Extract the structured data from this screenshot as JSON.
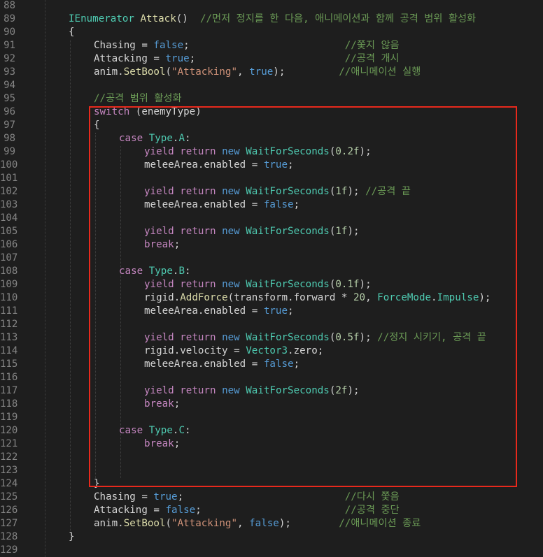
{
  "editor": {
    "theme": "dark",
    "colors": {
      "background": "#1e1e1e",
      "line_number": "#858585",
      "type": "#4ec9b0",
      "function": "#dcdcaa",
      "keyword": "#569cd6",
      "control": "#c586c0",
      "string": "#ce9178",
      "number": "#b5cea8",
      "comment": "#6a9955",
      "highlight_box": "#e8291c"
    },
    "line_numbers": [
      "88",
      "89",
      "90",
      "91",
      "92",
      "93",
      "94",
      "95",
      "96",
      "97",
      "98",
      "99",
      "100",
      "101",
      "102",
      "103",
      "104",
      "105",
      "106",
      "107",
      "108",
      "109",
      "110",
      "111",
      "112",
      "113",
      "114",
      "115",
      "116",
      "117",
      "118",
      "119",
      "120",
      "121",
      "122",
      "123",
      "124",
      "125",
      "126",
      "127",
      "128",
      "129"
    ],
    "lines": [
      [],
      [
        {
          "t": "IEnumerator",
          "c": "type"
        },
        {
          "t": " "
        },
        {
          "t": "Attack",
          "c": "fn"
        },
        {
          "t": "()  "
        },
        {
          "t": "//먼저 정지를 한 다음, 애니메이션과 함께 공격 범위 활성화",
          "c": "cmt"
        }
      ],
      [
        {
          "t": "{"
        }
      ],
      [
        {
          "t": "Chasing"
        },
        {
          "t": " = "
        },
        {
          "t": "false",
          "c": "kw"
        },
        {
          "t": ";                          "
        },
        {
          "t": "//쫓지 않음",
          "c": "cmt"
        }
      ],
      [
        {
          "t": "Attacking"
        },
        {
          "t": " = "
        },
        {
          "t": "true",
          "c": "kw"
        },
        {
          "t": ";                         "
        },
        {
          "t": "//공격 개시",
          "c": "cmt"
        }
      ],
      [
        {
          "t": "anim"
        },
        {
          "t": "."
        },
        {
          "t": "SetBool",
          "c": "fn"
        },
        {
          "t": "("
        },
        {
          "t": "\"Attacking\"",
          "c": "str"
        },
        {
          "t": ", "
        },
        {
          "t": "true",
          "c": "kw"
        },
        {
          "t": ");         "
        },
        {
          "t": "//애니메이션 실행",
          "c": "cmt"
        }
      ],
      [],
      [
        {
          "t": "//공격 범위 활성화",
          "c": "cmt"
        }
      ],
      [
        {
          "t": "switch",
          "c": "ctrl"
        },
        {
          "t": " (enemyType)"
        }
      ],
      [
        {
          "t": "{"
        }
      ],
      [
        {
          "t": "case",
          "c": "ctrl"
        },
        {
          "t": " "
        },
        {
          "t": "Type",
          "c": "type"
        },
        {
          "t": "."
        },
        {
          "t": "A",
          "c": "type"
        },
        {
          "t": ":"
        }
      ],
      [
        {
          "t": "yield",
          "c": "ctrl"
        },
        {
          "t": " "
        },
        {
          "t": "return",
          "c": "ctrl"
        },
        {
          "t": " "
        },
        {
          "t": "new",
          "c": "kw"
        },
        {
          "t": " "
        },
        {
          "t": "WaitForSeconds",
          "c": "type"
        },
        {
          "t": "("
        },
        {
          "t": "0.2f",
          "c": "num"
        },
        {
          "t": ");"
        }
      ],
      [
        {
          "t": "meleeArea"
        },
        {
          "t": "."
        },
        {
          "t": "enabled"
        },
        {
          "t": " = "
        },
        {
          "t": "true",
          "c": "kw"
        },
        {
          "t": ";"
        }
      ],
      [],
      [
        {
          "t": "yield",
          "c": "ctrl"
        },
        {
          "t": " "
        },
        {
          "t": "return",
          "c": "ctrl"
        },
        {
          "t": " "
        },
        {
          "t": "new",
          "c": "kw"
        },
        {
          "t": " "
        },
        {
          "t": "WaitForSeconds",
          "c": "type"
        },
        {
          "t": "("
        },
        {
          "t": "1f",
          "c": "num"
        },
        {
          "t": "); "
        },
        {
          "t": "//공격 끝",
          "c": "cmt"
        }
      ],
      [
        {
          "t": "meleeArea"
        },
        {
          "t": "."
        },
        {
          "t": "enabled"
        },
        {
          "t": " = "
        },
        {
          "t": "false",
          "c": "kw"
        },
        {
          "t": ";"
        }
      ],
      [],
      [
        {
          "t": "yield",
          "c": "ctrl"
        },
        {
          "t": " "
        },
        {
          "t": "return",
          "c": "ctrl"
        },
        {
          "t": " "
        },
        {
          "t": "new",
          "c": "kw"
        },
        {
          "t": " "
        },
        {
          "t": "WaitForSeconds",
          "c": "type"
        },
        {
          "t": "("
        },
        {
          "t": "1f",
          "c": "num"
        },
        {
          "t": ");"
        }
      ],
      [
        {
          "t": "break",
          "c": "ctrl"
        },
        {
          "t": ";"
        }
      ],
      [],
      [
        {
          "t": "case",
          "c": "ctrl"
        },
        {
          "t": " "
        },
        {
          "t": "Type",
          "c": "type"
        },
        {
          "t": "."
        },
        {
          "t": "B",
          "c": "type"
        },
        {
          "t": ":"
        }
      ],
      [
        {
          "t": "yield",
          "c": "ctrl"
        },
        {
          "t": " "
        },
        {
          "t": "return",
          "c": "ctrl"
        },
        {
          "t": " "
        },
        {
          "t": "new",
          "c": "kw"
        },
        {
          "t": " "
        },
        {
          "t": "WaitForSeconds",
          "c": "type"
        },
        {
          "t": "("
        },
        {
          "t": "0.1f",
          "c": "num"
        },
        {
          "t": ");"
        }
      ],
      [
        {
          "t": "rigid"
        },
        {
          "t": "."
        },
        {
          "t": "AddForce",
          "c": "fn"
        },
        {
          "t": "(transform.forward * "
        },
        {
          "t": "20",
          "c": "num"
        },
        {
          "t": ", "
        },
        {
          "t": "ForceMode",
          "c": "type"
        },
        {
          "t": "."
        },
        {
          "t": "Impulse",
          "c": "type"
        },
        {
          "t": ");"
        }
      ],
      [
        {
          "t": "meleeArea"
        },
        {
          "t": "."
        },
        {
          "t": "enabled"
        },
        {
          "t": " = "
        },
        {
          "t": "true",
          "c": "kw"
        },
        {
          "t": ";"
        }
      ],
      [],
      [
        {
          "t": "yield",
          "c": "ctrl"
        },
        {
          "t": " "
        },
        {
          "t": "return",
          "c": "ctrl"
        },
        {
          "t": " "
        },
        {
          "t": "new",
          "c": "kw"
        },
        {
          "t": " "
        },
        {
          "t": "WaitForSeconds",
          "c": "type"
        },
        {
          "t": "("
        },
        {
          "t": "0.5f",
          "c": "num"
        },
        {
          "t": "); "
        },
        {
          "t": "//정지 시키기, 공격 끝",
          "c": "cmt"
        }
      ],
      [
        {
          "t": "rigid"
        },
        {
          "t": "."
        },
        {
          "t": "velocity"
        },
        {
          "t": " = "
        },
        {
          "t": "Vector3",
          "c": "type"
        },
        {
          "t": "."
        },
        {
          "t": "zero"
        },
        {
          "t": ";"
        }
      ],
      [
        {
          "t": "meleeArea"
        },
        {
          "t": "."
        },
        {
          "t": "enabled"
        },
        {
          "t": " = "
        },
        {
          "t": "false",
          "c": "kw"
        },
        {
          "t": ";"
        }
      ],
      [],
      [
        {
          "t": "yield",
          "c": "ctrl"
        },
        {
          "t": " "
        },
        {
          "t": "return",
          "c": "ctrl"
        },
        {
          "t": " "
        },
        {
          "t": "new",
          "c": "kw"
        },
        {
          "t": " "
        },
        {
          "t": "WaitForSeconds",
          "c": "type"
        },
        {
          "t": "("
        },
        {
          "t": "2f",
          "c": "num"
        },
        {
          "t": ");"
        }
      ],
      [
        {
          "t": "break",
          "c": "ctrl"
        },
        {
          "t": ";"
        }
      ],
      [],
      [
        {
          "t": "case",
          "c": "ctrl"
        },
        {
          "t": " "
        },
        {
          "t": "Type",
          "c": "type"
        },
        {
          "t": "."
        },
        {
          "t": "C",
          "c": "type"
        },
        {
          "t": ":"
        }
      ],
      [
        {
          "t": "break",
          "c": "ctrl"
        },
        {
          "t": ";"
        }
      ],
      [],
      [],
      [
        {
          "t": "}"
        }
      ],
      [
        {
          "t": "Chasing"
        },
        {
          "t": " = "
        },
        {
          "t": "true",
          "c": "kw"
        },
        {
          "t": ";                           "
        },
        {
          "t": "//다시 쫓음",
          "c": "cmt"
        }
      ],
      [
        {
          "t": "Attacking"
        },
        {
          "t": " = "
        },
        {
          "t": "false",
          "c": "kw"
        },
        {
          "t": ";                        "
        },
        {
          "t": "//공격 중단",
          "c": "cmt"
        }
      ],
      [
        {
          "t": "anim"
        },
        {
          "t": "."
        },
        {
          "t": "SetBool",
          "c": "fn"
        },
        {
          "t": "("
        },
        {
          "t": "\"Attacking\"",
          "c": "str"
        },
        {
          "t": ", "
        },
        {
          "t": "false",
          "c": "kw"
        },
        {
          "t": ");        "
        },
        {
          "t": "//애니메이션 종료",
          "c": "cmt"
        }
      ],
      [
        {
          "t": "}"
        }
      ],
      []
    ]
  }
}
